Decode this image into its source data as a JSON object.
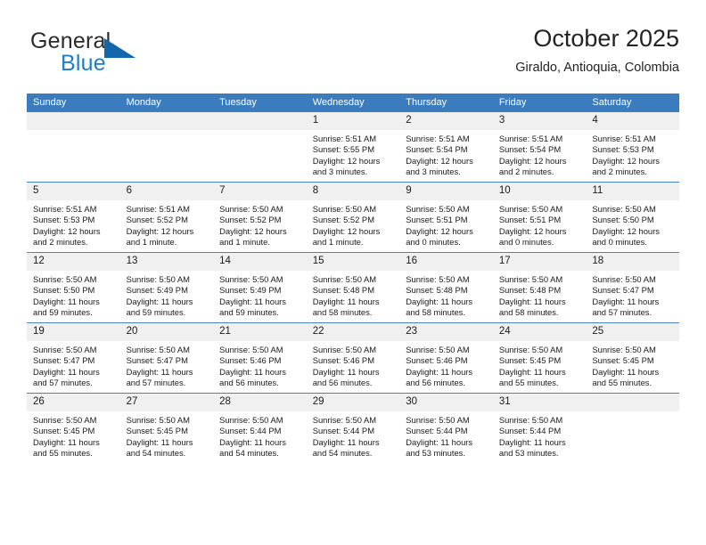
{
  "brand": {
    "name_part1": "General",
    "name_part2": "Blue",
    "triangle_color": "#1567ad",
    "blue_color": "#1f7fc4"
  },
  "header": {
    "title": "October 2025",
    "subtitle": "Giraldo, Antioquia, Colombia"
  },
  "calendar": {
    "header_bg": "#3a7cbe",
    "daynum_bg": "#f0f0f0",
    "row_border": "#4a82bd",
    "weekday_headers": [
      "Sunday",
      "Monday",
      "Tuesday",
      "Wednesday",
      "Thursday",
      "Friday",
      "Saturday"
    ],
    "weeks": [
      [
        {
          "day": "",
          "sunrise": "",
          "sunset": "",
          "daylight": ""
        },
        {
          "day": "",
          "sunrise": "",
          "sunset": "",
          "daylight": ""
        },
        {
          "day": "",
          "sunrise": "",
          "sunset": "",
          "daylight": ""
        },
        {
          "day": "1",
          "sunrise": "Sunrise: 5:51 AM",
          "sunset": "Sunset: 5:55 PM",
          "daylight": "Daylight: 12 hours and 3 minutes."
        },
        {
          "day": "2",
          "sunrise": "Sunrise: 5:51 AM",
          "sunset": "Sunset: 5:54 PM",
          "daylight": "Daylight: 12 hours and 3 minutes."
        },
        {
          "day": "3",
          "sunrise": "Sunrise: 5:51 AM",
          "sunset": "Sunset: 5:54 PM",
          "daylight": "Daylight: 12 hours and 2 minutes."
        },
        {
          "day": "4",
          "sunrise": "Sunrise: 5:51 AM",
          "sunset": "Sunset: 5:53 PM",
          "daylight": "Daylight: 12 hours and 2 minutes."
        }
      ],
      [
        {
          "day": "5",
          "sunrise": "Sunrise: 5:51 AM",
          "sunset": "Sunset: 5:53 PM",
          "daylight": "Daylight: 12 hours and 2 minutes."
        },
        {
          "day": "6",
          "sunrise": "Sunrise: 5:51 AM",
          "sunset": "Sunset: 5:52 PM",
          "daylight": "Daylight: 12 hours and 1 minute."
        },
        {
          "day": "7",
          "sunrise": "Sunrise: 5:50 AM",
          "sunset": "Sunset: 5:52 PM",
          "daylight": "Daylight: 12 hours and 1 minute."
        },
        {
          "day": "8",
          "sunrise": "Sunrise: 5:50 AM",
          "sunset": "Sunset: 5:52 PM",
          "daylight": "Daylight: 12 hours and 1 minute."
        },
        {
          "day": "9",
          "sunrise": "Sunrise: 5:50 AM",
          "sunset": "Sunset: 5:51 PM",
          "daylight": "Daylight: 12 hours and 0 minutes."
        },
        {
          "day": "10",
          "sunrise": "Sunrise: 5:50 AM",
          "sunset": "Sunset: 5:51 PM",
          "daylight": "Daylight: 12 hours and 0 minutes."
        },
        {
          "day": "11",
          "sunrise": "Sunrise: 5:50 AM",
          "sunset": "Sunset: 5:50 PM",
          "daylight": "Daylight: 12 hours and 0 minutes."
        }
      ],
      [
        {
          "day": "12",
          "sunrise": "Sunrise: 5:50 AM",
          "sunset": "Sunset: 5:50 PM",
          "daylight": "Daylight: 11 hours and 59 minutes."
        },
        {
          "day": "13",
          "sunrise": "Sunrise: 5:50 AM",
          "sunset": "Sunset: 5:49 PM",
          "daylight": "Daylight: 11 hours and 59 minutes."
        },
        {
          "day": "14",
          "sunrise": "Sunrise: 5:50 AM",
          "sunset": "Sunset: 5:49 PM",
          "daylight": "Daylight: 11 hours and 59 minutes."
        },
        {
          "day": "15",
          "sunrise": "Sunrise: 5:50 AM",
          "sunset": "Sunset: 5:48 PM",
          "daylight": "Daylight: 11 hours and 58 minutes."
        },
        {
          "day": "16",
          "sunrise": "Sunrise: 5:50 AM",
          "sunset": "Sunset: 5:48 PM",
          "daylight": "Daylight: 11 hours and 58 minutes."
        },
        {
          "day": "17",
          "sunrise": "Sunrise: 5:50 AM",
          "sunset": "Sunset: 5:48 PM",
          "daylight": "Daylight: 11 hours and 58 minutes."
        },
        {
          "day": "18",
          "sunrise": "Sunrise: 5:50 AM",
          "sunset": "Sunset: 5:47 PM",
          "daylight": "Daylight: 11 hours and 57 minutes."
        }
      ],
      [
        {
          "day": "19",
          "sunrise": "Sunrise: 5:50 AM",
          "sunset": "Sunset: 5:47 PM",
          "daylight": "Daylight: 11 hours and 57 minutes."
        },
        {
          "day": "20",
          "sunrise": "Sunrise: 5:50 AM",
          "sunset": "Sunset: 5:47 PM",
          "daylight": "Daylight: 11 hours and 57 minutes."
        },
        {
          "day": "21",
          "sunrise": "Sunrise: 5:50 AM",
          "sunset": "Sunset: 5:46 PM",
          "daylight": "Daylight: 11 hours and 56 minutes."
        },
        {
          "day": "22",
          "sunrise": "Sunrise: 5:50 AM",
          "sunset": "Sunset: 5:46 PM",
          "daylight": "Daylight: 11 hours and 56 minutes."
        },
        {
          "day": "23",
          "sunrise": "Sunrise: 5:50 AM",
          "sunset": "Sunset: 5:46 PM",
          "daylight": "Daylight: 11 hours and 56 minutes."
        },
        {
          "day": "24",
          "sunrise": "Sunrise: 5:50 AM",
          "sunset": "Sunset: 5:45 PM",
          "daylight": "Daylight: 11 hours and 55 minutes."
        },
        {
          "day": "25",
          "sunrise": "Sunrise: 5:50 AM",
          "sunset": "Sunset: 5:45 PM",
          "daylight": "Daylight: 11 hours and 55 minutes."
        }
      ],
      [
        {
          "day": "26",
          "sunrise": "Sunrise: 5:50 AM",
          "sunset": "Sunset: 5:45 PM",
          "daylight": "Daylight: 11 hours and 55 minutes."
        },
        {
          "day": "27",
          "sunrise": "Sunrise: 5:50 AM",
          "sunset": "Sunset: 5:45 PM",
          "daylight": "Daylight: 11 hours and 54 minutes."
        },
        {
          "day": "28",
          "sunrise": "Sunrise: 5:50 AM",
          "sunset": "Sunset: 5:44 PM",
          "daylight": "Daylight: 11 hours and 54 minutes."
        },
        {
          "day": "29",
          "sunrise": "Sunrise: 5:50 AM",
          "sunset": "Sunset: 5:44 PM",
          "daylight": "Daylight: 11 hours and 54 minutes."
        },
        {
          "day": "30",
          "sunrise": "Sunrise: 5:50 AM",
          "sunset": "Sunset: 5:44 PM",
          "daylight": "Daylight: 11 hours and 53 minutes."
        },
        {
          "day": "31",
          "sunrise": "Sunrise: 5:50 AM",
          "sunset": "Sunset: 5:44 PM",
          "daylight": "Daylight: 11 hours and 53 minutes."
        },
        {
          "day": "",
          "sunrise": "",
          "sunset": "",
          "daylight": ""
        }
      ]
    ]
  }
}
